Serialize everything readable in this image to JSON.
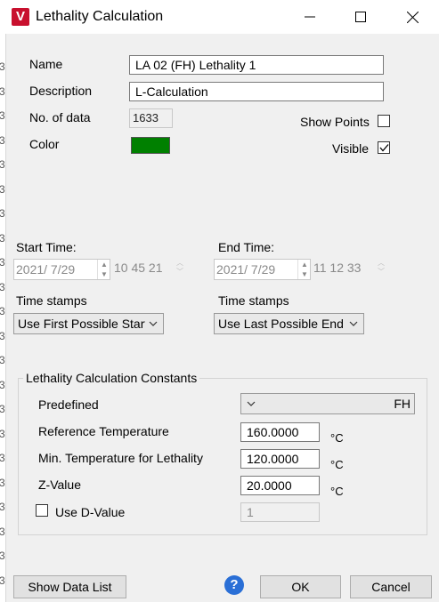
{
  "window": {
    "title": "Lethality Calculation",
    "app_icon_letter": "V"
  },
  "left_strip": {
    "digits": [
      "3",
      "3",
      "3",
      "3",
      "3",
      "3",
      "3",
      "3",
      "3",
      "3",
      "3",
      "3",
      "3",
      "3",
      "3",
      "3",
      "3",
      "3",
      "3",
      "3",
      "3",
      "3"
    ]
  },
  "form": {
    "name_label": "Name",
    "name_value": "LA 02 (FH)  Lethality 1",
    "description_label": "Description",
    "description_value": "L-Calculation",
    "no_of_data_label": "No. of data",
    "no_of_data_value": "1633",
    "color_label": "Color",
    "color_value": "#008000",
    "show_points_label": "Show Points",
    "show_points_checked": false,
    "visible_label": "Visible",
    "visible_checked": true
  },
  "time": {
    "start_label": "Start Time:",
    "start_date": "2021/  7/29",
    "start_clock": "10 45 21",
    "end_label": "End Time:",
    "end_date": "2021/  7/29",
    "end_clock": "11 12 33",
    "start_stamps_label": "Time stamps",
    "start_stamps_value": "Use First Possible Start",
    "end_stamps_label": "Time stamps",
    "end_stamps_value": "Use Last Possible End"
  },
  "constants": {
    "group_title": "Lethality Calculation Constants",
    "predefined_label": "Predefined",
    "predefined_value": "FH",
    "ref_temp_label": "Reference Temperature",
    "ref_temp_value": "160.0000",
    "ref_temp_unit": "°C",
    "min_temp_label": "Min. Temperature for Lethality",
    "min_temp_value": "120.0000",
    "min_temp_unit": "°C",
    "z_label": "Z-Value",
    "z_value": "20.0000",
    "z_unit": "°C",
    "use_d_label": "Use D-Value",
    "use_d_checked": false,
    "d_value": "1"
  },
  "buttons": {
    "show_data_list": "Show Data List",
    "ok": "OK",
    "cancel": "Cancel",
    "help_symbol": "?"
  }
}
